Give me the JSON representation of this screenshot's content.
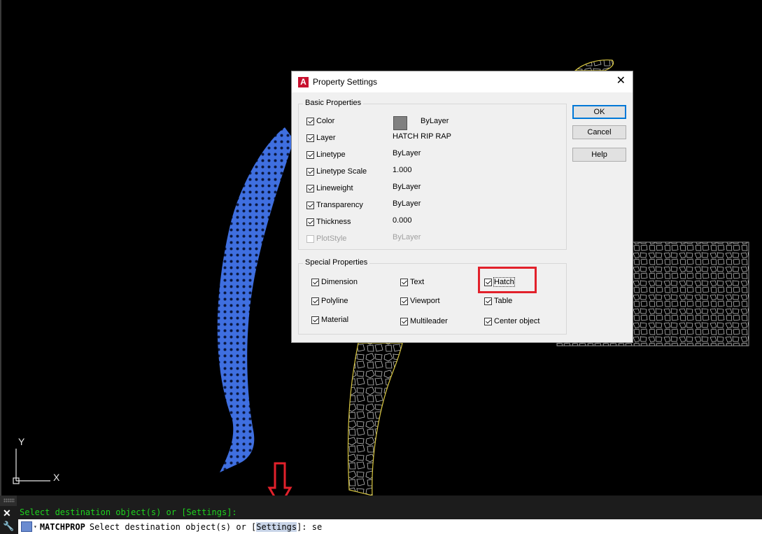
{
  "dialog": {
    "title": "Property Settings",
    "close_glyph": "✕",
    "basic_group": "Basic Properties",
    "basic": [
      {
        "label": "Color",
        "value": "ByLayer",
        "checked": true,
        "enabled": true
      },
      {
        "label": "Layer",
        "value": "HATCH RIP RAP",
        "checked": true,
        "enabled": true
      },
      {
        "label": "Linetype",
        "value": "ByLayer",
        "checked": true,
        "enabled": true
      },
      {
        "label": "Linetype Scale",
        "value": "1.000",
        "checked": true,
        "enabled": true
      },
      {
        "label": "Lineweight",
        "value": "ByLayer",
        "checked": true,
        "enabled": true
      },
      {
        "label": "Transparency",
        "value": "ByLayer",
        "checked": true,
        "enabled": true
      },
      {
        "label": "Thickness",
        "value": "0.000",
        "checked": true,
        "enabled": true
      },
      {
        "label": "PlotStyle",
        "value": "ByLayer",
        "checked": false,
        "enabled": false
      }
    ],
    "special_group": "Special Properties",
    "special": [
      {
        "label": "Dimension",
        "checked": true
      },
      {
        "label": "Text",
        "checked": true
      },
      {
        "label": "Hatch",
        "checked": true
      },
      {
        "label": "Polyline",
        "checked": true
      },
      {
        "label": "Viewport",
        "checked": true
      },
      {
        "label": "Table",
        "checked": true
      },
      {
        "label": "Material",
        "checked": true
      },
      {
        "label": "Multileader",
        "checked": true
      },
      {
        "label": "Center object",
        "checked": true
      }
    ],
    "buttons": {
      "ok": "OK",
      "cancel": "Cancel",
      "help": "Help"
    }
  },
  "ucs": {
    "y": "Y",
    "x": "X"
  },
  "command_line": {
    "history": "Select destination object(s) or [Settings]:",
    "command_name": "MATCHPROP",
    "prompt_before": "Select destination object(s) or [",
    "prompt_option": "Settings",
    "prompt_after": "]: se"
  },
  "colors": {
    "accent_red": "#e2212b",
    "hatch_blue": "#3f6fe0",
    "command_green": "#1ed31e"
  }
}
